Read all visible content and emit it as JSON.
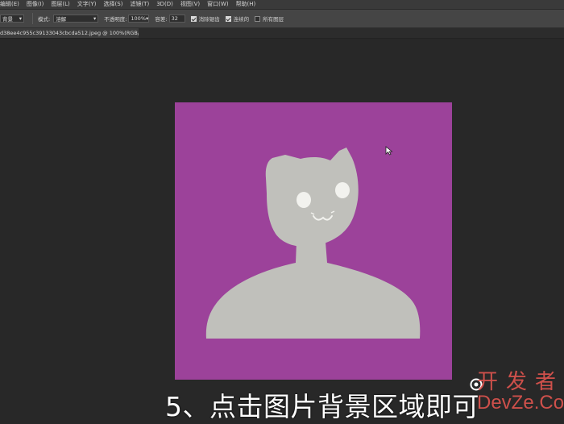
{
  "menu": {
    "items": [
      "编辑(E)",
      "图像(I)",
      "图层(L)",
      "文字(Y)",
      "选择(S)",
      "滤镜(T)",
      "3D(D)",
      "视图(V)",
      "窗口(W)",
      "帮助(H)"
    ]
  },
  "options": {
    "layer_sample": "背景",
    "mode_label": "模式:",
    "mode_value": "溶解",
    "opacity_label": "不透明度:",
    "opacity_value": "100%",
    "tolerance_label": "容差:",
    "tolerance_value": "32",
    "antialias_label": "消除锯齿",
    "contiguous_label": "连续的",
    "all_layers_label": "所有图层"
  },
  "document": {
    "tab_title": "d38ee4c955c39133043cbcda512.jpeg @ 100%(RGB/8#) *",
    "close_glyph": "×"
  },
  "colors": {
    "canvas_bg": "#9c429a",
    "figure": "#c0c0bb",
    "eye": "#f2f2ee",
    "workspace": "#282828"
  },
  "caption": "5、点击图片背景区域即可",
  "watermark": {
    "title": "开发者",
    "subtitle": "DevZe.CoM"
  }
}
